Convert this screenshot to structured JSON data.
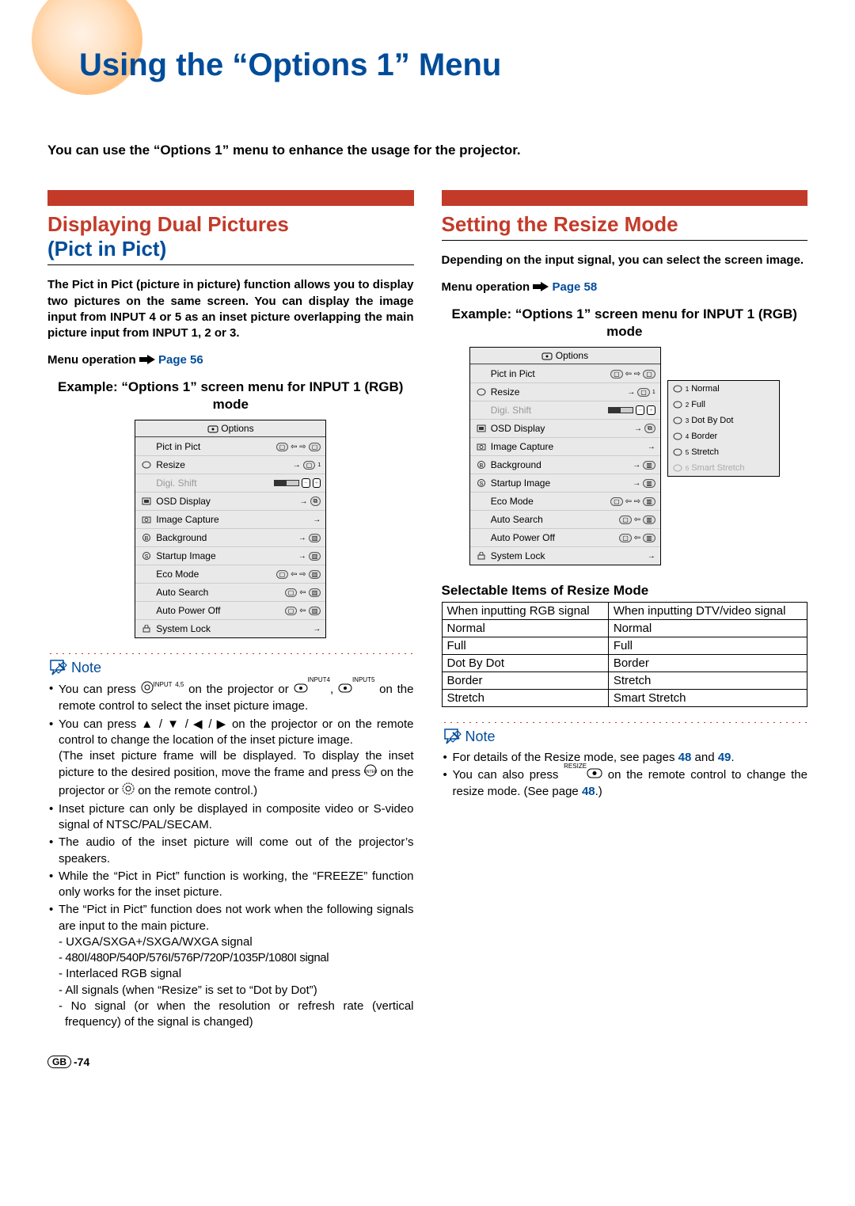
{
  "title": "Using the “Options 1” Menu",
  "intro": "You can use the “Options 1” menu to enhance the usage for the projector.",
  "left": {
    "heading_main": "Displaying Dual Pictures",
    "heading_sub": "(Pict in Pict)",
    "para": "The Pict in Pict (picture in picture) function allows you to display two pictures on the same screen. You can display the image input from INPUT 4 or 5 as an inset picture overlapping the main picture input from INPUT 1, 2 or 3.",
    "menu_op": "Menu operation",
    "menu_op_page": "Page 56",
    "example": "Example: “Options 1” screen menu for INPUT 1 (RGB) mode",
    "osd": {
      "header": "Options",
      "items": [
        {
          "label": "Pict in Pict"
        },
        {
          "label": "Resize"
        },
        {
          "label": "Digi. Shift",
          "dim": true
        },
        {
          "label": "OSD Display"
        },
        {
          "label": "Image Capture"
        },
        {
          "label": "Background"
        },
        {
          "label": "Startup Image"
        },
        {
          "label": "Eco Mode"
        },
        {
          "label": "Auto Search"
        },
        {
          "label": "Auto Power Off"
        },
        {
          "label": "System Lock"
        }
      ]
    },
    "note_label": "Note",
    "notes": [
      "You can press  [INPUT 4/5]  on the projector or  [INPUT4], [INPUT5]  on the remote control to select the inset picture image.",
      "You can press ▲ / ▼ / ◀ / ▶ on the projector or on the remote control to change the location of the inset picture image.\n(The inset picture frame will be displayed. To display the inset picture to the desired position, move the frame and press  [ENTER]  on the projector or  [ENTER]  on the remote control.)",
      "Inset picture can only be displayed in composite video or S-video signal of NTSC/PAL/SECAM.",
      "The audio of the inset picture will come out of the projector’s speakers.",
      "While the “Pict in Pict” function is working, the “FREEZE” function only works for the inset picture.",
      "The “Pict in Pict” function does not work when the following signals are input to the main picture."
    ],
    "subnotes": [
      "UXGA/SXGA+/SXGA/WXGA signal",
      "480I/480P/540P/576I/576P/720P/1035P/1080I signal",
      "Interlaced RGB signal",
      "All signals (when “Resize” is set to “Dot by Dot”)",
      "No signal (or when the resolution or refresh rate (vertical frequency) of the signal is changed)"
    ]
  },
  "right": {
    "heading": "Setting the Resize Mode",
    "para": "Depending on the input signal, you can select the screen image.",
    "menu_op": "Menu operation",
    "menu_op_page": "Page 58",
    "example": "Example: “Options 1” screen menu for INPUT 1 (RGB) mode",
    "side_options": [
      {
        "n": "1",
        "label": "Normal"
      },
      {
        "n": "2",
        "label": "Full"
      },
      {
        "n": "3",
        "label": "Dot By Dot"
      },
      {
        "n": "4",
        "label": "Border"
      },
      {
        "n": "5",
        "label": "Stretch"
      },
      {
        "n": "6",
        "label": "Smart Stretch",
        "dim": true
      }
    ],
    "table_title": "Selectable Items of Resize Mode",
    "table": {
      "headers": [
        "When inputting RGB signal",
        "When inputting DTV/video signal"
      ],
      "rows": [
        [
          "Normal",
          "Normal"
        ],
        [
          "Full",
          "Full"
        ],
        [
          "Dot By Dot",
          "Border"
        ],
        [
          "Border",
          "Stretch"
        ],
        [
          "Stretch",
          "Smart Stretch"
        ]
      ]
    },
    "note_label": "Note",
    "notes_pre": "For details of the Resize mode, see pages ",
    "notes_p1": "48",
    "notes_mid": " and ",
    "notes_p2": "49",
    "notes_post": ".",
    "note2_pre": "You can also press ",
    "note2_icon_label": "RESIZE",
    "note2_post": " on the remote control to change the resize mode. (See page ",
    "note2_page": "48",
    "note2_end": ".)"
  },
  "footer": {
    "gb": "GB",
    "num": "-74"
  }
}
